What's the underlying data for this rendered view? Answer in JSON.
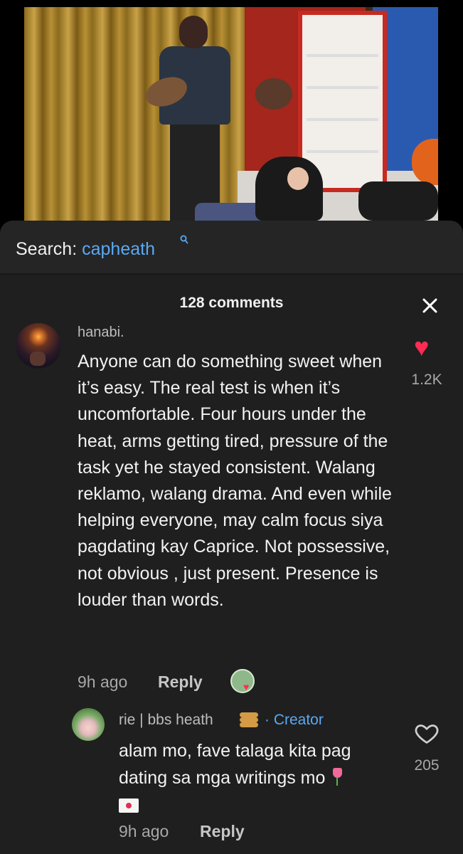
{
  "search": {
    "label": "Search:",
    "term": "capheath",
    "icon": "search-icon"
  },
  "comments": {
    "count_label": "128 comments",
    "items": [
      {
        "username": "hanabi.",
        "text": "Anyone can do something sweet when it’s easy. The real test is when it’s uncomfortable. Four hours under the heat, arms getting tired, pressure of the task yet he stayed consistent. Walang reklamo, walang drama. And even while helping everyone, may calm focus siya pagdating kay Caprice. Not possessive, not obvious , just present. Presence is louder than words.",
        "time": "9h ago",
        "reply_label": "Reply",
        "likes": "1.2K",
        "liked": true
      }
    ],
    "replies": [
      {
        "username": "rie | bbs heath",
        "creator_label": "· Creator",
        "text": "alam mo, fave talaga kita pag dating sa mga writings mo",
        "time": "9h ago",
        "reply_label": "Reply",
        "likes": "205",
        "liked": false
      }
    ]
  },
  "colors": {
    "background": "#1f1f1f",
    "accent_blue": "#5aa9f5",
    "like_red": "#fe2c55"
  }
}
